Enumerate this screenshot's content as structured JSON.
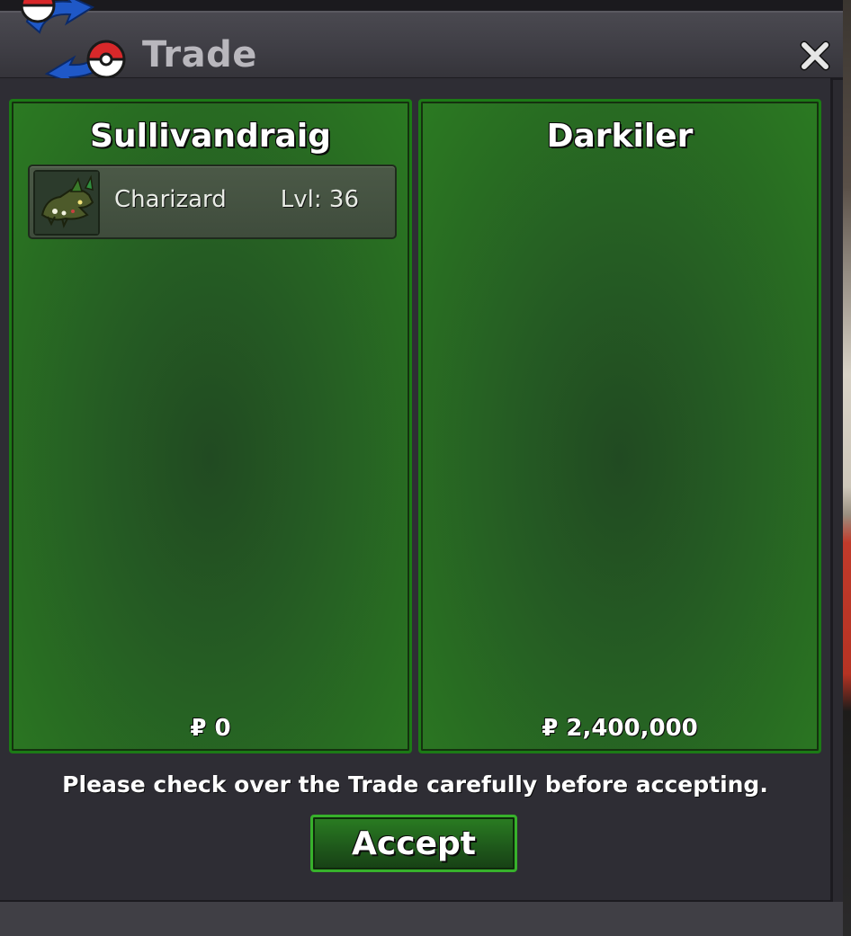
{
  "window": {
    "title": "Trade",
    "close_icon": "close-icon",
    "logo_icon": "pokeball-trade-icon"
  },
  "trade": {
    "left": {
      "player_name": "Sullivandraig",
      "items": [
        {
          "icon": "charizard-sprite-icon",
          "name": "Charizard",
          "level": "Lvl: 36"
        }
      ],
      "money": "₽ 0"
    },
    "right": {
      "player_name": "Darkiler",
      "items": [],
      "money": "₽ 2,400,000"
    }
  },
  "footer": {
    "notice": "Please check over the Trade carefully before accepting.",
    "accept_label": "Accept"
  },
  "colors": {
    "panel_border": "#1c7a16",
    "accept_border": "#37b12b",
    "title_text": "#b9b7bd"
  }
}
